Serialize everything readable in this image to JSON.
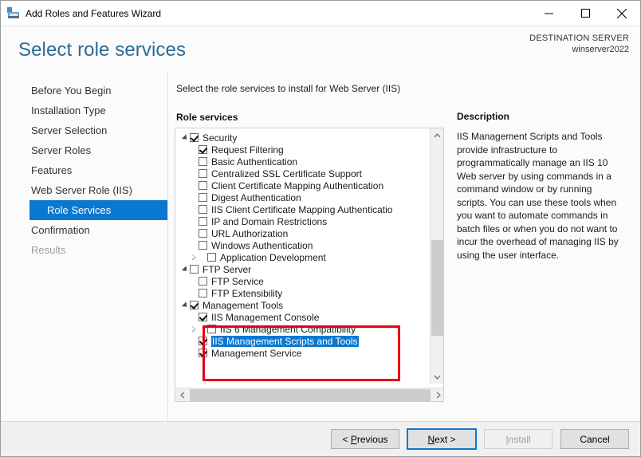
{
  "window": {
    "title": "Add Roles and Features Wizard",
    "app_icon": "server-wizard-icon",
    "minimize": "minimize-icon",
    "maximize": "maximize-icon",
    "close": "close-icon"
  },
  "header": {
    "page_title": "Select role services",
    "destination_label": "DESTINATION SERVER",
    "destination_server": "winserver2022"
  },
  "sidebar": {
    "items": [
      {
        "label": "Before You Begin",
        "state": "normal",
        "level": 0
      },
      {
        "label": "Installation Type",
        "state": "normal",
        "level": 0
      },
      {
        "label": "Server Selection",
        "state": "normal",
        "level": 0
      },
      {
        "label": "Server Roles",
        "state": "normal",
        "level": 0
      },
      {
        "label": "Features",
        "state": "normal",
        "level": 0
      },
      {
        "label": "Web Server Role (IIS)",
        "state": "normal",
        "level": 0
      },
      {
        "label": "Role Services",
        "state": "active",
        "level": 1
      },
      {
        "label": "Confirmation",
        "state": "normal",
        "level": 0
      },
      {
        "label": "Results",
        "state": "disabled",
        "level": 0
      }
    ]
  },
  "main": {
    "instruction": "Select the role services to install for Web Server (IIS)",
    "role_services_label": "Role services",
    "tree": [
      {
        "label": "Security",
        "checked": true,
        "expander": "open",
        "indent": 0
      },
      {
        "label": "Request Filtering",
        "checked": true,
        "expander": "none",
        "indent": 1
      },
      {
        "label": "Basic Authentication",
        "checked": false,
        "expander": "none",
        "indent": 1
      },
      {
        "label": "Centralized SSL Certificate Support",
        "checked": false,
        "expander": "none",
        "indent": 1
      },
      {
        "label": "Client Certificate Mapping Authentication",
        "checked": false,
        "expander": "none",
        "indent": 1
      },
      {
        "label": "Digest Authentication",
        "checked": false,
        "expander": "none",
        "indent": 1
      },
      {
        "label": "IIS Client Certificate Mapping Authenticatio",
        "checked": false,
        "expander": "none",
        "indent": 1
      },
      {
        "label": "IP and Domain Restrictions",
        "checked": false,
        "expander": "none",
        "indent": 1
      },
      {
        "label": "URL Authorization",
        "checked": false,
        "expander": "none",
        "indent": 1
      },
      {
        "label": "Windows Authentication",
        "checked": false,
        "expander": "none",
        "indent": 1
      },
      {
        "label": "Application Development",
        "checked": false,
        "expander": "closed",
        "indent": 1
      },
      {
        "label": "FTP Server",
        "checked": false,
        "expander": "open",
        "indent": 0
      },
      {
        "label": "FTP Service",
        "checked": false,
        "expander": "none",
        "indent": 1
      },
      {
        "label": "FTP Extensibility",
        "checked": false,
        "expander": "none",
        "indent": 1
      },
      {
        "label": "Management Tools",
        "checked": true,
        "expander": "open",
        "indent": 0
      },
      {
        "label": "IIS Management Console",
        "checked": true,
        "expander": "none",
        "indent": 1
      },
      {
        "label": "IIS 6 Management Compatibility",
        "checked": false,
        "expander": "closed",
        "indent": 1
      },
      {
        "label": "IIS Management Scripts and Tools",
        "checked": true,
        "expander": "none",
        "indent": 1,
        "selected": true
      },
      {
        "label": "Management Service",
        "checked": true,
        "expander": "none",
        "indent": 1
      }
    ],
    "scroll": {
      "up_arrow": "chevron-up-icon",
      "down_arrow": "chevron-down-icon",
      "left_arrow": "chevron-left-icon",
      "right_arrow": "chevron-right-icon"
    },
    "highlight_color": "#e60012"
  },
  "description": {
    "title": "Description",
    "text": "IIS Management Scripts and Tools provide infrastructure to programmatically manage an IIS 10 Web server by using commands in a command window or by running scripts. You can use these tools when you want to automate commands in batch files or when you do not want to incur the overhead of managing IIS by using the user interface."
  },
  "footer": {
    "previous": "< Previous",
    "previous_accel": "P",
    "next": "Next >",
    "next_accel": "N",
    "install": "Install",
    "install_accel": "I",
    "cancel": "Cancel"
  },
  "colors": {
    "accent_blue": "#0a78d1",
    "title_blue": "#2c6b96",
    "annotation_red": "#e60012"
  }
}
